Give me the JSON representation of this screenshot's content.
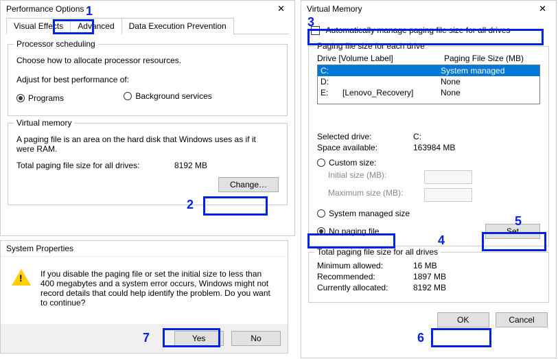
{
  "perf": {
    "title": "Performance Options",
    "tabs": {
      "ve": "Visual Effects",
      "adv": "Advanced",
      "dep": "Data Execution Prevention"
    },
    "ps": {
      "title": "Processor scheduling",
      "desc": "Choose how to allocate processor resources.",
      "adjust": "Adjust for best performance of:",
      "programs": "Programs",
      "bg": "Background services"
    },
    "vm": {
      "title": "Virtual memory",
      "desc": "A paging file is an area on the hard disk that Windows uses as if it were RAM.",
      "total_lbl": "Total paging file size for all drives:",
      "total_val": "8192 MB",
      "change": "Change…"
    }
  },
  "vmd": {
    "title": "Virtual Memory",
    "auto": "Automatically manage paging file size for all drives",
    "each": {
      "title": "Paging file size for each drive",
      "hdr_drive": "Drive  [Volume Label]",
      "hdr_size": "Paging File Size (MB)",
      "rows": [
        {
          "d": "C:",
          "l": "",
          "s": "System managed"
        },
        {
          "d": "D:",
          "l": "",
          "s": "None"
        },
        {
          "d": "E:",
          "l": "[Lenovo_Recovery]",
          "s": "None"
        }
      ]
    },
    "sel_drive_lbl": "Selected drive:",
    "sel_drive_val": "C:",
    "space_lbl": "Space available:",
    "space_val": "163984 MB",
    "custom": "Custom size:",
    "init": "Initial size (MB):",
    "max": "Maximum size (MB):",
    "sysman": "System managed size",
    "nopf": "No paging file",
    "set": "Set",
    "tot": {
      "title": "Total paging file size for all drives",
      "min_lbl": "Minimum allowed:",
      "min_val": "16 MB",
      "rec_lbl": "Recommended:",
      "rec_val": "1897 MB",
      "cur_lbl": "Currently allocated:",
      "cur_val": "8192 MB"
    },
    "ok": "OK",
    "cancel": "Cancel"
  },
  "sp": {
    "title": "System Properties",
    "msg": "If you disable the paging file or set the initial size to less than 400 megabytes and a system error occurs, Windows might not record details that could help identify the problem. Do you want to continue?",
    "yes": "Yes",
    "no": "No"
  },
  "ann": {
    "1": "1",
    "2": "2",
    "3": "3",
    "4": "4",
    "5": "5",
    "6": "6",
    "7": "7"
  }
}
